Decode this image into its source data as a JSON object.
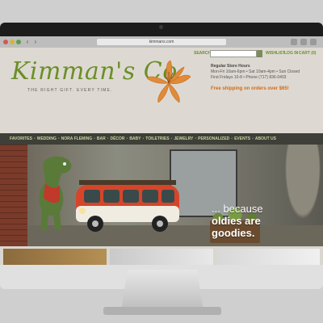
{
  "browser": {
    "url": "kimmans.com"
  },
  "header": {
    "logo_text": "Kimman's Co.",
    "tagline": "THE RIGHT GIFT. EVERY TIME.",
    "search_label": "SEARCH",
    "wishlist_label": "WISHLIST",
    "login_label": "LOG IN",
    "cart_label": "CART (0)",
    "store_hours": {
      "title": "Regular Store Hours",
      "line1": "Mon-Fri 10am-6pm • Sat 10am-4pm • Sun Closed",
      "line2": "First Fridays 10-8 • Phone (717) 836-0403"
    },
    "free_shipping": "Free shipping on orders over $65!"
  },
  "nav": {
    "items": [
      "FAVORITES",
      "WEDDING",
      "NORA FLEMING",
      "BAR",
      "DÉCOR",
      "BABY",
      "TOILETRIES",
      "JEWELRY",
      "PERSONALIZED",
      "EVENTS",
      "ABOUT US"
    ]
  },
  "hero": {
    "caption_line1": "... because",
    "caption_line2": "oldies are",
    "caption_line3": "goodies."
  },
  "colors": {
    "brand_green": "#6b8f27",
    "accent_orange": "#d36a12",
    "nav_bg": "#3d3f38"
  },
  "icons": {
    "logo_flower": "lily-flower-icon",
    "cart": "cart-icon",
    "prev": "chevron-left-icon",
    "next": "chevron-right-icon"
  }
}
